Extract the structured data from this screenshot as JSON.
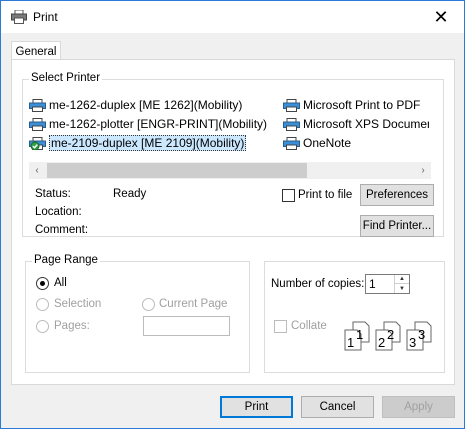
{
  "window": {
    "title": "Print",
    "close_glyph": "✕"
  },
  "tabs": [
    {
      "label": "General"
    }
  ],
  "select_printer": {
    "group_label": "Select Printer",
    "printers_left": [
      {
        "name": "me-1262-duplex [ME 1262](Mobility)",
        "icon": "printer-icon"
      },
      {
        "name": "me-1262-plotter [ENGR-PRINT](Mobility)",
        "icon": "printer-icon"
      },
      {
        "name": "me-2109-duplex [ME 2109](Mobility)",
        "icon": "default-printer-icon",
        "selected": true
      }
    ],
    "printers_right": [
      {
        "name": "Microsoft Print to PDF",
        "icon": "printer-icon"
      },
      {
        "name": "Microsoft XPS Documen",
        "icon": "printer-icon"
      },
      {
        "name": "OneNote",
        "icon": "printer-icon"
      }
    ],
    "scroll_left": "‹",
    "scroll_right": "›",
    "status_label": "Status:",
    "status_value": "Ready",
    "location_label": "Location:",
    "comment_label": "Comment:",
    "print_to_file_label": "Print to file",
    "preferences_label": "Preferences",
    "find_printer_label": "Find Printer..."
  },
  "page_range": {
    "group_label": "Page Range",
    "all_label": "All",
    "selection_label": "Selection",
    "current_page_label": "Current Page",
    "pages_label": "Pages:"
  },
  "copies": {
    "label": "Number of copies:",
    "value": "1",
    "collate_label": "Collate"
  },
  "footer": {
    "print_label": "Print",
    "cancel_label": "Cancel",
    "apply_label": "Apply"
  },
  "colors": {
    "accent": "#0078d7",
    "selection": "#cce8ff"
  }
}
